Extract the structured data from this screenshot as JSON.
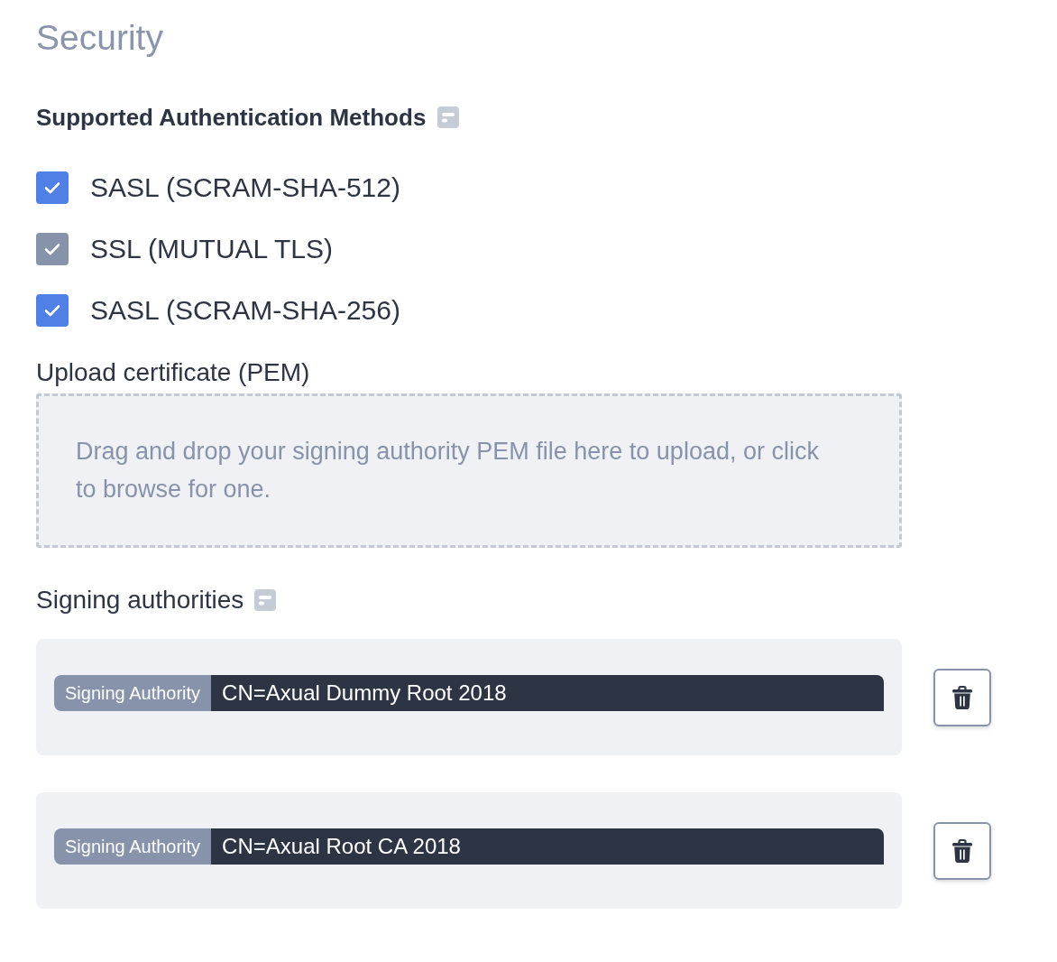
{
  "title": "Security",
  "authentication": {
    "label": "Supported Authentication Methods",
    "methods": [
      {
        "label": "SASL (SCRAM-SHA-512)",
        "checked": true,
        "disabled": false
      },
      {
        "label": "SSL (MUTUAL TLS)",
        "checked": true,
        "disabled": true
      },
      {
        "label": "SASL (SCRAM-SHA-256)",
        "checked": true,
        "disabled": false
      }
    ]
  },
  "upload": {
    "label": "Upload certificate (PEM)",
    "dropzone_text": "Drag and drop your signing authority PEM file here to upload, or click to browse for one."
  },
  "signing_authorities": {
    "label": "Signing authorities",
    "items": [
      {
        "tag": "Signing Authority",
        "value": "CN=Axual Dummy Root 2018"
      },
      {
        "tag": "Signing Authority",
        "value": "CN=Axual Root CA 2018"
      }
    ]
  }
}
